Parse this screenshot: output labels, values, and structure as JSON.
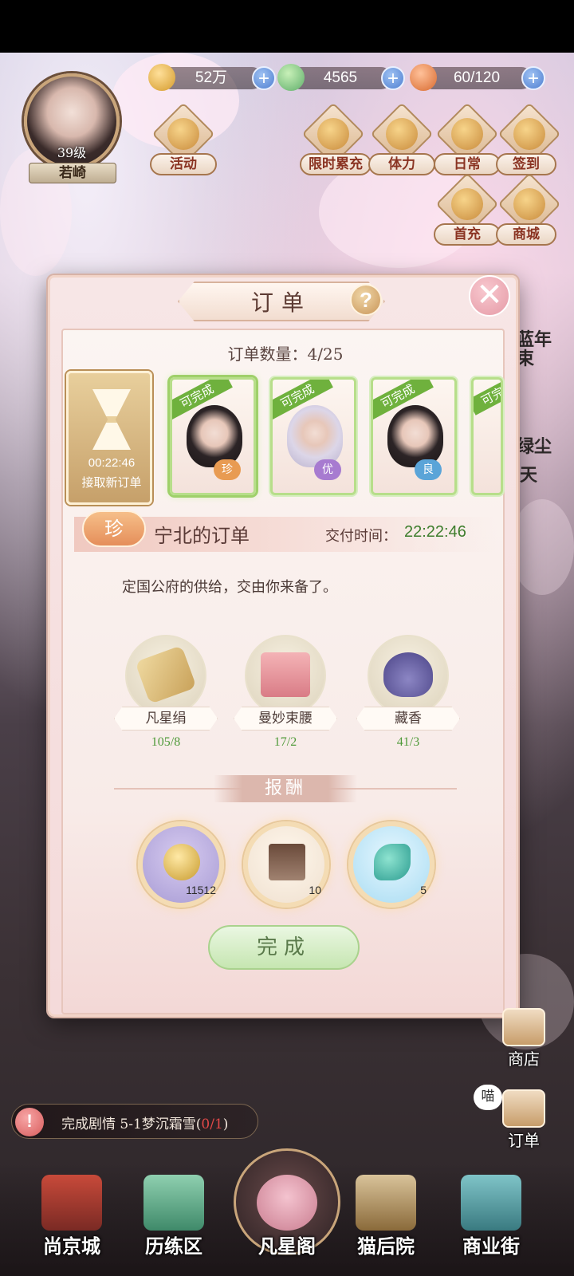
{
  "resources": [
    {
      "icon": "paw-coin-icon",
      "value": "52万"
    },
    {
      "icon": "jade-icon",
      "value": "4565"
    },
    {
      "icon": "bun-icon",
      "value": "60/120"
    }
  ],
  "player": {
    "level": "39级",
    "name": "若崎"
  },
  "top_buttons": [
    {
      "icon": "activity-icon",
      "label": "活动"
    },
    {
      "icon": "limited-recharge-icon",
      "label": "限时累充"
    },
    {
      "icon": "stamina-icon",
      "label": "体力"
    },
    {
      "icon": "daily-icon",
      "label": "日常"
    },
    {
      "icon": "signin-icon",
      "label": "签到"
    },
    {
      "icon": "first-charge-icon",
      "label": "首充"
    },
    {
      "icon": "mall-icon",
      "label": "商城"
    }
  ],
  "background_text": {
    "line1": "蓝年",
    "line2": "束",
    "line3": "绿尘",
    "line4": "天"
  },
  "dialog": {
    "title": "订单",
    "order_count_label": "订单数量：",
    "order_count_value": "4/25",
    "timer": {
      "time": "00:22:46",
      "label": "接取新订单"
    },
    "orders": [
      {
        "status": "可完成",
        "grade": "珍",
        "color": "#e89b52"
      },
      {
        "status": "可完成",
        "grade": "优",
        "color": "#a77bd0"
      },
      {
        "status": "可完成",
        "grade": "良",
        "color": "#5aa4d8"
      },
      {
        "status": "可完",
        "grade": "",
        "color": "#cccccc"
      }
    ],
    "selected": {
      "grade": "珍",
      "title": "宁北的订单",
      "deliver_label": "交付时间：",
      "deliver_time": "22:22:46",
      "description": "定国公府的供给，交由你来备了。",
      "requirements": [
        {
          "icon": "silk-roll-icon",
          "name": "凡星绢",
          "count": "105/8"
        },
        {
          "icon": "waistband-icon",
          "name": "曼妙束腰",
          "count": "17/2"
        },
        {
          "icon": "sachet-icon",
          "name": "藏香",
          "count": "41/3"
        }
      ],
      "reward_label": "报酬",
      "rewards": [
        {
          "icon": "paw-coin-icon",
          "qty": "11512"
        },
        {
          "icon": "pavilion-icon",
          "qty": "10"
        },
        {
          "icon": "fish-icon",
          "qty": "5"
        }
      ],
      "complete_label": "完成"
    }
  },
  "side_buttons": [
    {
      "icon": "shop-icon",
      "label": "商店"
    },
    {
      "icon": "order-icon",
      "label": "订单",
      "bubble": "喵"
    }
  ],
  "quest": {
    "icon": "!",
    "text": "完成剧情 5-1梦沉霜雪(",
    "progress": "0/1",
    "suffix": ")"
  },
  "nav": [
    {
      "icon": "capital-icon",
      "label": "尚京城"
    },
    {
      "icon": "training-icon",
      "label": "历练区"
    },
    {
      "icon": "star-pavilion-icon",
      "label": "凡星阁"
    },
    {
      "icon": "cat-yard-icon",
      "label": "猫后院"
    },
    {
      "icon": "market-street-icon",
      "label": "商业街"
    }
  ]
}
